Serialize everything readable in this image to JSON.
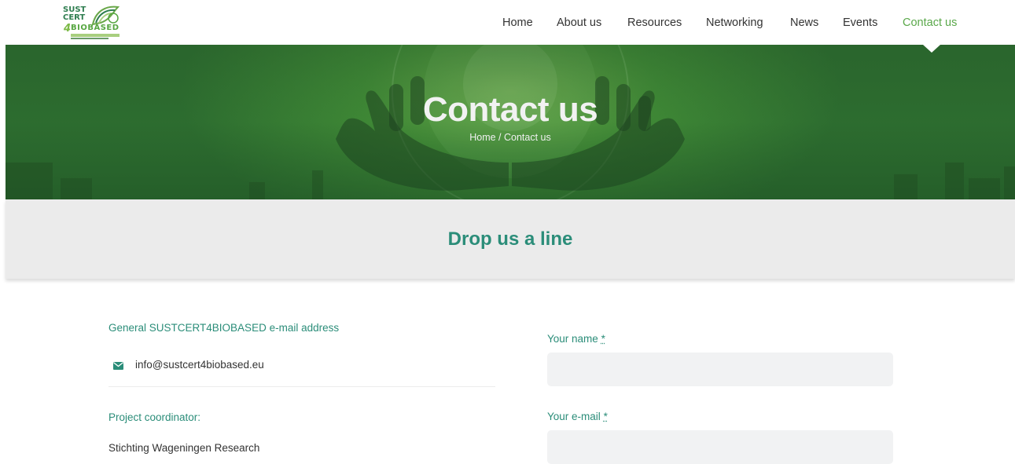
{
  "logo": {
    "line1": "SUST",
    "line2": "CERT",
    "four": "4",
    "line3": "BIOBASED"
  },
  "nav": {
    "items": [
      {
        "label": "Home"
      },
      {
        "label": "About us"
      },
      {
        "label": "Resources"
      },
      {
        "label": "Networking"
      },
      {
        "label": "News"
      },
      {
        "label": "Events"
      },
      {
        "label": "Contact us",
        "active": true
      }
    ],
    "active_color": "#5aa84a"
  },
  "hero": {
    "title": "Contact us",
    "breadcrumb_home": "Home",
    "breadcrumb_separator": " / ",
    "breadcrumb_current": "Contact us"
  },
  "band": {
    "title": "Drop us a line"
  },
  "contact": {
    "general_label": "General SUSTCERT4BIOBASED e-mail address",
    "email_icon": "envelope-icon",
    "email": "info@sustcert4biobased.eu",
    "coordinator_label": "Project coordinator:",
    "coordinator_org": "Stichting Wageningen Research"
  },
  "form": {
    "name_label": "Your name",
    "name_required": "*",
    "name_value": "",
    "email_label": "Your e-mail",
    "email_required": "*",
    "email_value": ""
  },
  "colors": {
    "accent_teal": "#2b8d79",
    "hero_green": "#3f8a36",
    "band_grey": "#ebebeb",
    "input_bg": "#f1f2f3"
  }
}
